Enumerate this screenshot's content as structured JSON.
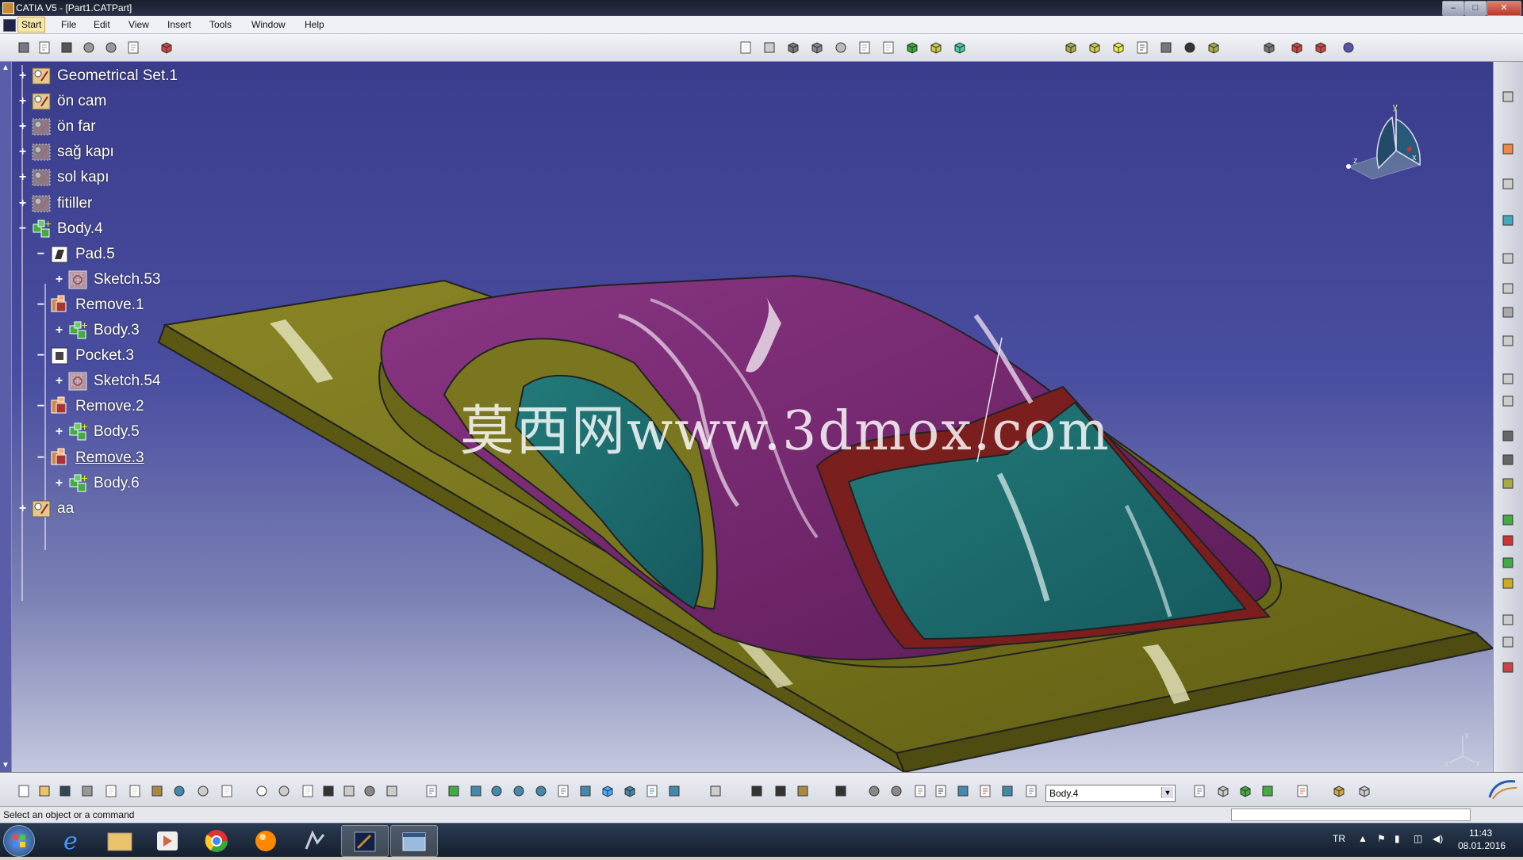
{
  "window": {
    "title": "CATIA V5 - [Part1.CATPart]"
  },
  "menu": {
    "items": [
      "Start",
      "File",
      "Edit",
      "View",
      "Insert",
      "Tools",
      "Window",
      "Help"
    ]
  },
  "tree": {
    "nodes": [
      {
        "label": "Geometrical Set.1",
        "icon": "geometrical-set-icon",
        "expander": "+",
        "depth": 0
      },
      {
        "label": "ön cam",
        "icon": "geometrical-set-icon",
        "expander": "+",
        "depth": 0
      },
      {
        "label": "ön far",
        "icon": "hidden-geometrical-set-icon",
        "expander": "+",
        "depth": 0
      },
      {
        "label": "sağ kapı",
        "icon": "hidden-geometrical-set-icon",
        "expander": "+",
        "depth": 0
      },
      {
        "label": "sol kapı",
        "icon": "hidden-geometrical-set-icon",
        "expander": "+",
        "depth": 0
      },
      {
        "label": "fitiller",
        "icon": "hidden-geometrical-set-icon",
        "expander": "+",
        "depth": 0
      },
      {
        "label": "Body.4",
        "icon": "body-icon",
        "expander": "−",
        "depth": 0
      },
      {
        "label": "Pad.5",
        "icon": "pad-icon",
        "expander": "−",
        "depth": 1
      },
      {
        "label": "Sketch.53",
        "icon": "sketch-icon",
        "expander": "+",
        "depth": 2
      },
      {
        "label": "Remove.1",
        "icon": "remove-icon",
        "expander": "−",
        "depth": 1
      },
      {
        "label": "Body.3",
        "icon": "body-icon",
        "expander": "+",
        "depth": 2
      },
      {
        "label": "Pocket.3",
        "icon": "pocket-icon",
        "expander": "−",
        "depth": 1
      },
      {
        "label": "Sketch.54",
        "icon": "sketch-icon",
        "expander": "+",
        "depth": 2
      },
      {
        "label": "Remove.2",
        "icon": "remove-icon",
        "expander": "−",
        "depth": 1
      },
      {
        "label": "Body.5",
        "icon": "body-icon",
        "expander": "+",
        "depth": 2
      },
      {
        "label": "Remove.3",
        "icon": "remove-icon",
        "expander": "−",
        "depth": 1,
        "underlined": true
      },
      {
        "label": "Body.6",
        "icon": "body-icon",
        "expander": "+",
        "depth": 2
      },
      {
        "label": "aa",
        "icon": "geometrical-set-icon",
        "expander": "+",
        "depth": 0
      }
    ]
  },
  "compass": {
    "y": "y",
    "x": "x",
    "z": "z"
  },
  "axis_triad": {
    "y": "y",
    "x": "x",
    "z": "z"
  },
  "watermark": "莫西网www.3dmox.com",
  "toolbar": {
    "body_select": "Body.4"
  },
  "status": {
    "text": "Select an object or a command"
  },
  "taskbar": {
    "lang": "TR",
    "time": "11:43",
    "date": "08.01.2016"
  },
  "colors": {
    "car_body": "#7a2a74",
    "base_plate": "#75721c",
    "glass": "#1f6e70",
    "frame": "#7a1e1e",
    "viewport_top": "#3a3c8c"
  }
}
